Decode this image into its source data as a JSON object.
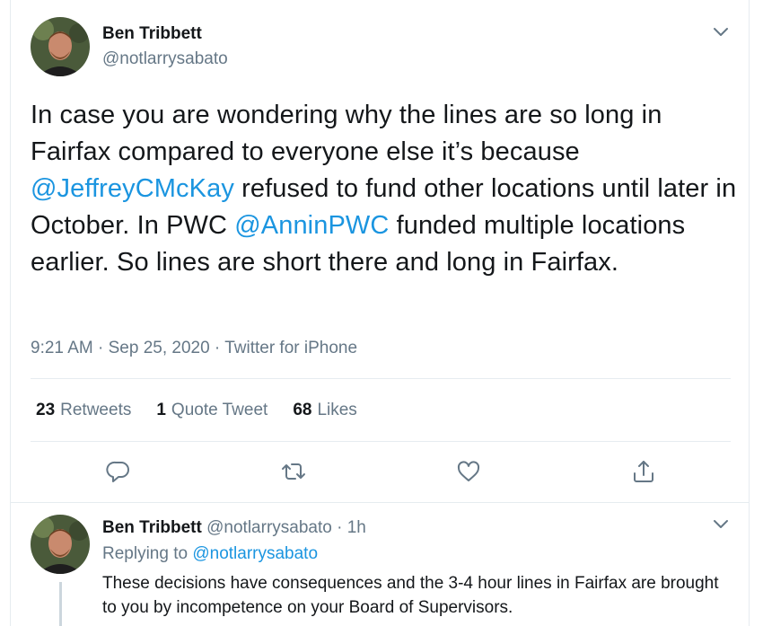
{
  "main_tweet": {
    "author_name": "Ben Tribbett",
    "author_handle": "@notlarrysabato",
    "text_1": "In case you are wondering why the lines are so long in Fairfax compared to everyone else it’s because ",
    "mention_1": "@JeffreyCMcKay",
    "text_2": " refused to fund other locations until later in October.  In PWC ",
    "mention_2": "@AnninPWC",
    "text_3": " funded multiple locations earlier.  So lines are short there and long in Fairfax.",
    "time": "9:21 AM",
    "separator_1": " · ",
    "date": "Sep 25, 2020",
    "separator_2": " · ",
    "source": "Twitter for iPhone"
  },
  "stats": {
    "retweets_count": "23",
    "retweets_label": "Retweets",
    "quotes_count": "1",
    "quotes_label": "Quote Tweet",
    "likes_count": "68",
    "likes_label": "Likes"
  },
  "actions": {
    "reply_icon": "reply-icon",
    "retweet_icon": "retweet-icon",
    "like_icon": "heart-icon",
    "share_icon": "share-icon"
  },
  "reply_tweet": {
    "author_name": "Ben Tribbett",
    "author_handle": "@notlarrysabato",
    "separator": " · ",
    "age": "1h",
    "replying_prefix": "Replying to ",
    "replying_to": "@notlarrysabato",
    "text": "These decisions have consequences and the 3-4 hour lines in Fairfax are brought to you by incompetence on your Board of Supervisors."
  },
  "colors": {
    "link": "#1b95e0",
    "secondary_text": "#657786",
    "primary_text": "#14171a",
    "divider": "#e6ecf0"
  }
}
